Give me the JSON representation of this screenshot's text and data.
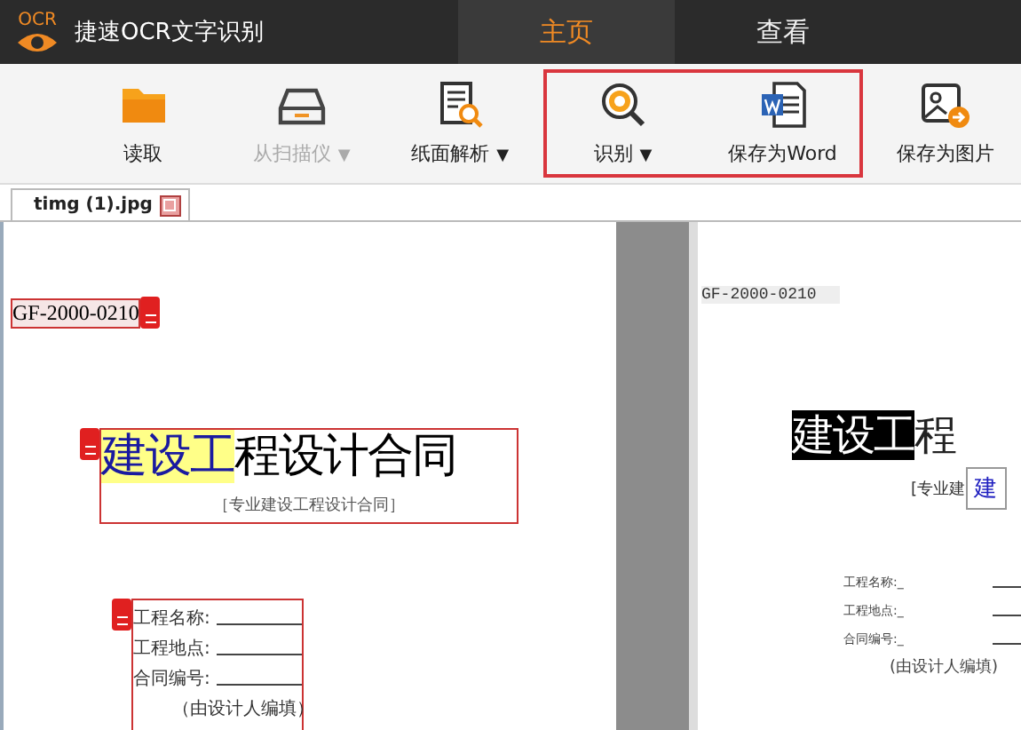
{
  "app": {
    "logo_text": "OCR",
    "title": "捷速OCR文字识别"
  },
  "nav_tabs": [
    {
      "label": "主页",
      "selected": true
    },
    {
      "label": "查看",
      "selected": false
    }
  ],
  "toolbar": [
    {
      "kind": "folder",
      "label": "读取",
      "disabled": false,
      "dropdown": false,
      "highlighted": false
    },
    {
      "kind": "scanner",
      "label": "从扫描仪",
      "disabled": true,
      "dropdown": true,
      "highlighted": false
    },
    {
      "kind": "page",
      "label": "纸面解析",
      "disabled": false,
      "dropdown": true,
      "highlighted": false
    },
    {
      "kind": "recognize",
      "label": "识别",
      "disabled": false,
      "dropdown": true,
      "highlighted": true
    },
    {
      "kind": "word",
      "label": "保存为Word",
      "disabled": false,
      "dropdown": false,
      "highlighted": true
    },
    {
      "kind": "image",
      "label": "保存为图片",
      "disabled": false,
      "dropdown": false,
      "highlighted": false
    }
  ],
  "dropdown_glyph": "▼",
  "file_tab": {
    "label": "timg (1).jpg"
  },
  "source_page": {
    "code": "GF-2000-0210",
    "title_highlight": "建设工",
    "title_rest": "程设计合同",
    "subtitle": "［专业建设工程设计合同］",
    "fields": [
      {
        "label": "工程名称:"
      },
      {
        "label": "工程地点:"
      },
      {
        "label": "合同编号:"
      }
    ],
    "note": "（由设计人编填）"
  },
  "result_page": {
    "code": "GF-2000-0210",
    "title_highlight": "建设工",
    "title_rest": "程",
    "subtitle": "[专业建",
    "tooltip": "建",
    "fields": [
      {
        "label": "工程名称:_"
      },
      {
        "label": "工程地点:_"
      },
      {
        "label": "合同编号:_"
      }
    ],
    "note": "(由设计人编填)"
  }
}
